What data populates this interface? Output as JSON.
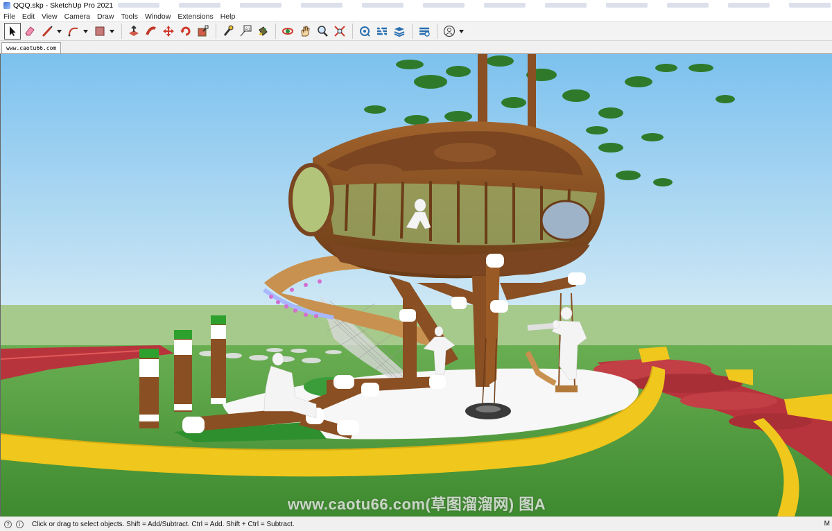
{
  "window": {
    "title": "QQQ.skp - SketchUp Pro 2021"
  },
  "menu": [
    "File",
    "Edit",
    "View",
    "Camera",
    "Draw",
    "Tools",
    "Window",
    "Extensions",
    "Help"
  ],
  "scene_tab": "www.caotu66.com",
  "toolbar": {
    "tools": [
      "select-icon",
      "eraser-icon",
      "line-icon",
      "arc-icon",
      "rectangle-icon",
      "push-pull-icon",
      "follow-me-icon",
      "move-icon",
      "rotate-icon",
      "scale-icon",
      "tape-measure-icon",
      "text-icon",
      "paint-bucket-icon",
      "orbit-icon",
      "pan-icon",
      "zoom-icon",
      "zoom-extents-icon",
      "warehouse-icon",
      "extension-warehouse-icon",
      "layout-icon",
      "extension-manager-icon",
      "account-icon"
    ]
  },
  "watermark": "www.caotu66.com(草图溜溜网) 图A",
  "status": {
    "text": "Click or drag to select objects. Shift = Add/Subtract. Ctrl = Add. Shift + Ctrl = Subtract.",
    "right": "M"
  },
  "colors": {
    "sky_top": "#7cc1ee",
    "sky_bottom": "#c6e4f4",
    "lawn": "#4f9a3c",
    "yellow_border": "#f0c71c",
    "red_steps": "#b8343c",
    "wood": "#8a4f22"
  }
}
